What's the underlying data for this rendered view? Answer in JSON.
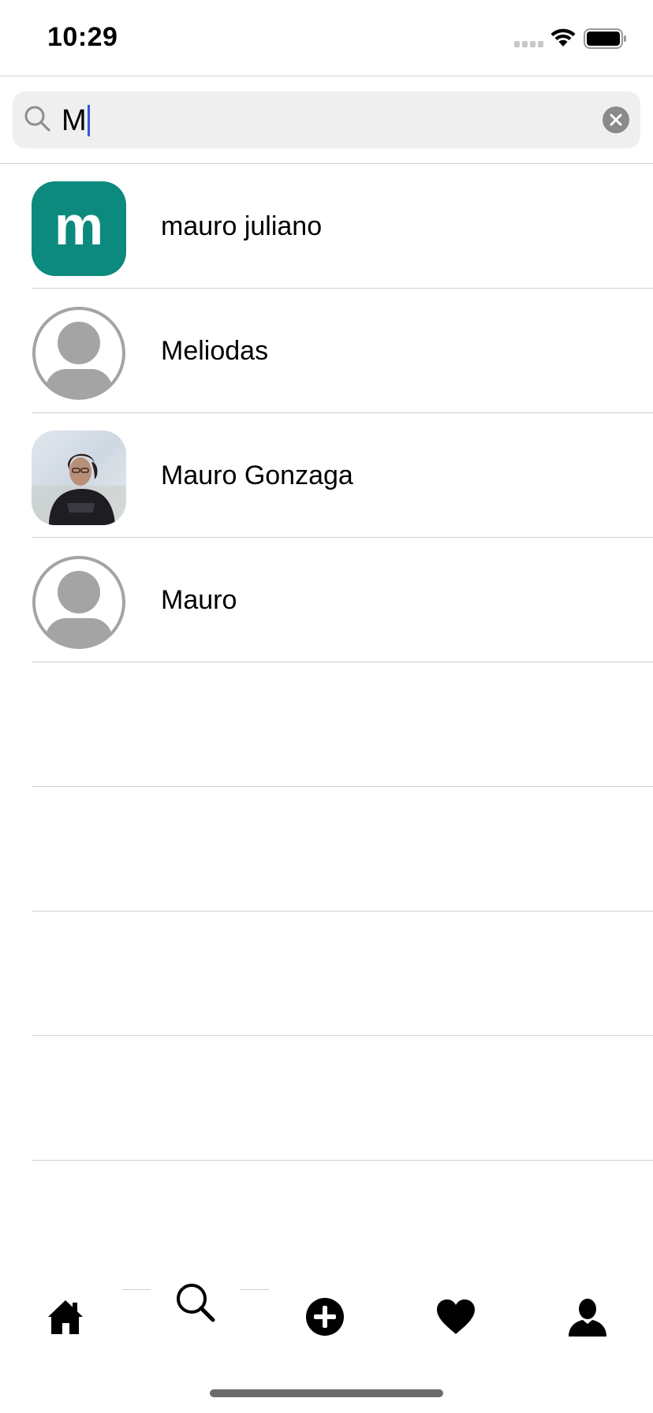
{
  "status_bar": {
    "time": "10:29"
  },
  "search": {
    "query": "M"
  },
  "results": [
    {
      "name": "mauro juliano",
      "avatar_type": "letter",
      "avatar_letter": "m",
      "avatar_color": "#0c8a7e"
    },
    {
      "name": "Meliodas",
      "avatar_type": "placeholder"
    },
    {
      "name": "Mauro Gonzaga",
      "avatar_type": "photo"
    },
    {
      "name": "Mauro",
      "avatar_type": "placeholder"
    }
  ],
  "tab_bar": {
    "tabs": [
      {
        "icon": "home-icon"
      },
      {
        "icon": "search-icon",
        "selected": true
      },
      {
        "icon": "add-circle-icon"
      },
      {
        "icon": "heart-icon"
      },
      {
        "icon": "profile-icon"
      }
    ]
  },
  "colors": {
    "accent_letter_avatar": "#0c8a7e",
    "caret": "#2d5bd8",
    "clear_button": "#8a8a8a"
  }
}
